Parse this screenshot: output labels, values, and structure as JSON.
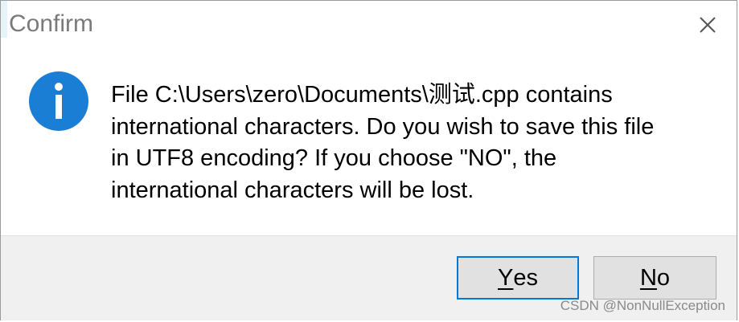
{
  "dialog": {
    "title": "Confirm",
    "close_icon": "close-icon",
    "icon": "info-icon",
    "icon_color": "#1a7fd4",
    "message_lines": [
      "File C:\\Users\\zero\\Documents\\测试.cpp contains",
      "international characters. Do you wish to save this file",
      "in UTF8 encoding? If you choose \"NO\", the",
      "international characters will be lost."
    ]
  },
  "buttons": {
    "yes": {
      "mnemonic": "Y",
      "rest": "es"
    },
    "no": {
      "mnemonic": "N",
      "rest": "o"
    }
  },
  "watermark": "CSDN @NonNullException",
  "colors": {
    "default_button_border": "#0078d7",
    "footer_background": "#f0f0f0"
  }
}
